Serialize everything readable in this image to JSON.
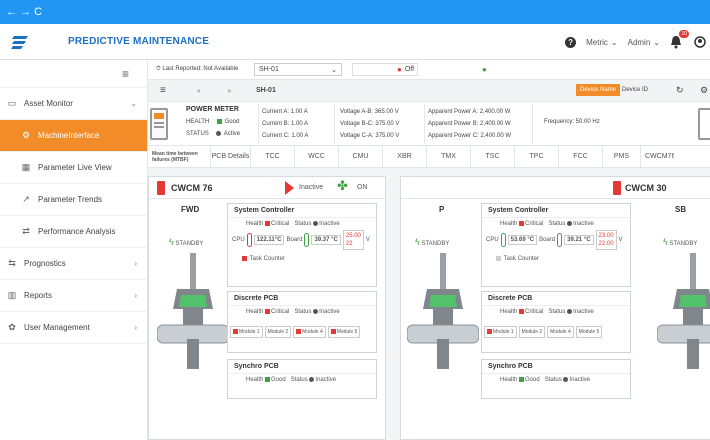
{
  "browser": {
    "nav": "← → C"
  },
  "header": {
    "title": "PREDICTIVE MAINTENANCE",
    "metric": "Metric",
    "admin": "Admin",
    "notif_count": "10"
  },
  "sidebar": {
    "items": [
      {
        "label": "Asset Monitor",
        "icon": "monitor-icon"
      },
      {
        "label": "MachineInterface",
        "icon": "interface-icon"
      },
      {
        "label": "Parameter Live View",
        "icon": "grid-icon"
      },
      {
        "label": "Parameter Trends",
        "icon": "trend-icon"
      },
      {
        "label": "Performance Analysis",
        "icon": "analysis-icon"
      },
      {
        "label": "Prognostics",
        "icon": "prognostics-icon"
      },
      {
        "label": "Reports",
        "icon": "reports-icon"
      },
      {
        "label": "User Management",
        "icon": "user-icon"
      }
    ]
  },
  "bar1": {
    "last_reported": "Last Reported: Not Available",
    "device": "SH-01",
    "status": "Off"
  },
  "bar2": {
    "title": "SH-01",
    "device_name": "Device Name",
    "device_id": "Device ID"
  },
  "power_meter": {
    "title": "POWER METER",
    "health_label": "HEALTH",
    "health_value": "Good",
    "status_label": "STATUS",
    "status_value": "Active",
    "currents": [
      "Current A: 1.00  A",
      "Current B: 1.00  A",
      "Current C: 1.00  A"
    ],
    "voltages": [
      "Voltage A-B: 365.00 V",
      "Voltage B-C: 375.00 V",
      "Voltage C-A: 375.00 V"
    ],
    "powers": [
      "Apparent Power A: 2,400.00 W",
      "Apparent Power B: 2,400.00 W",
      "Apparent Power C: 2,400.00 W"
    ],
    "frequency": "Frequency: 50.00 Hz"
  },
  "tabs": {
    "mtbf": "Mean time between failures (MTBF)",
    "items": [
      "PCB Details",
      "TCC",
      "WCC",
      "CMU",
      "XBR",
      "TMX",
      "TSC",
      "TPC",
      "FCC",
      "PMS",
      "CWCM76"
    ]
  },
  "panel_left": {
    "title": "CWCM 76",
    "inactive": "Inactive",
    "on": "ON",
    "unit": "FWD",
    "standby": "STANDBY",
    "sc_title": "System Controller",
    "health": "Health",
    "critical": "Critical",
    "status": "Status",
    "inactive_status": "Inactive",
    "cpu": "CPU",
    "cpu_val": "122.11°C",
    "board": "Board",
    "board_val": "39.37 °C",
    "v1": "25.00",
    "v2": "22",
    "vunit": "V",
    "task_counter": "Task Counter",
    "dpcb_title": "Discrete PCB",
    "modules": [
      "Module 1",
      "Module 2",
      "Module 4",
      "Module 5"
    ],
    "spcb_title": "Synchro PCB",
    "good": "Good"
  },
  "panel_right": {
    "title": "CWCM 30",
    "unit_p": "P",
    "unit_sb": "SB",
    "standby": "STANDBY",
    "sc_title": "System Controller",
    "health": "Health",
    "critical": "Critical",
    "status": "Status",
    "inactive_status": "Inactive",
    "cpu": "CPU",
    "cpu_val": "53.69 °C",
    "board": "Board",
    "board_val": "39.21 °C",
    "v1": "23.00",
    "v2": "22.00",
    "vunit": "V",
    "task_counter": "Task Counter",
    "dpcb_title": "Discrete PCB",
    "modules": [
      "Module 1",
      "Module 2",
      "Module 4",
      "Module 5"
    ],
    "spcb_title": "Synchro PCB",
    "good": "Good"
  },
  "colors": {
    "accent": "#f28c28",
    "brand": "#1f6fbf",
    "critical": "#e53935",
    "good": "#43a047"
  }
}
